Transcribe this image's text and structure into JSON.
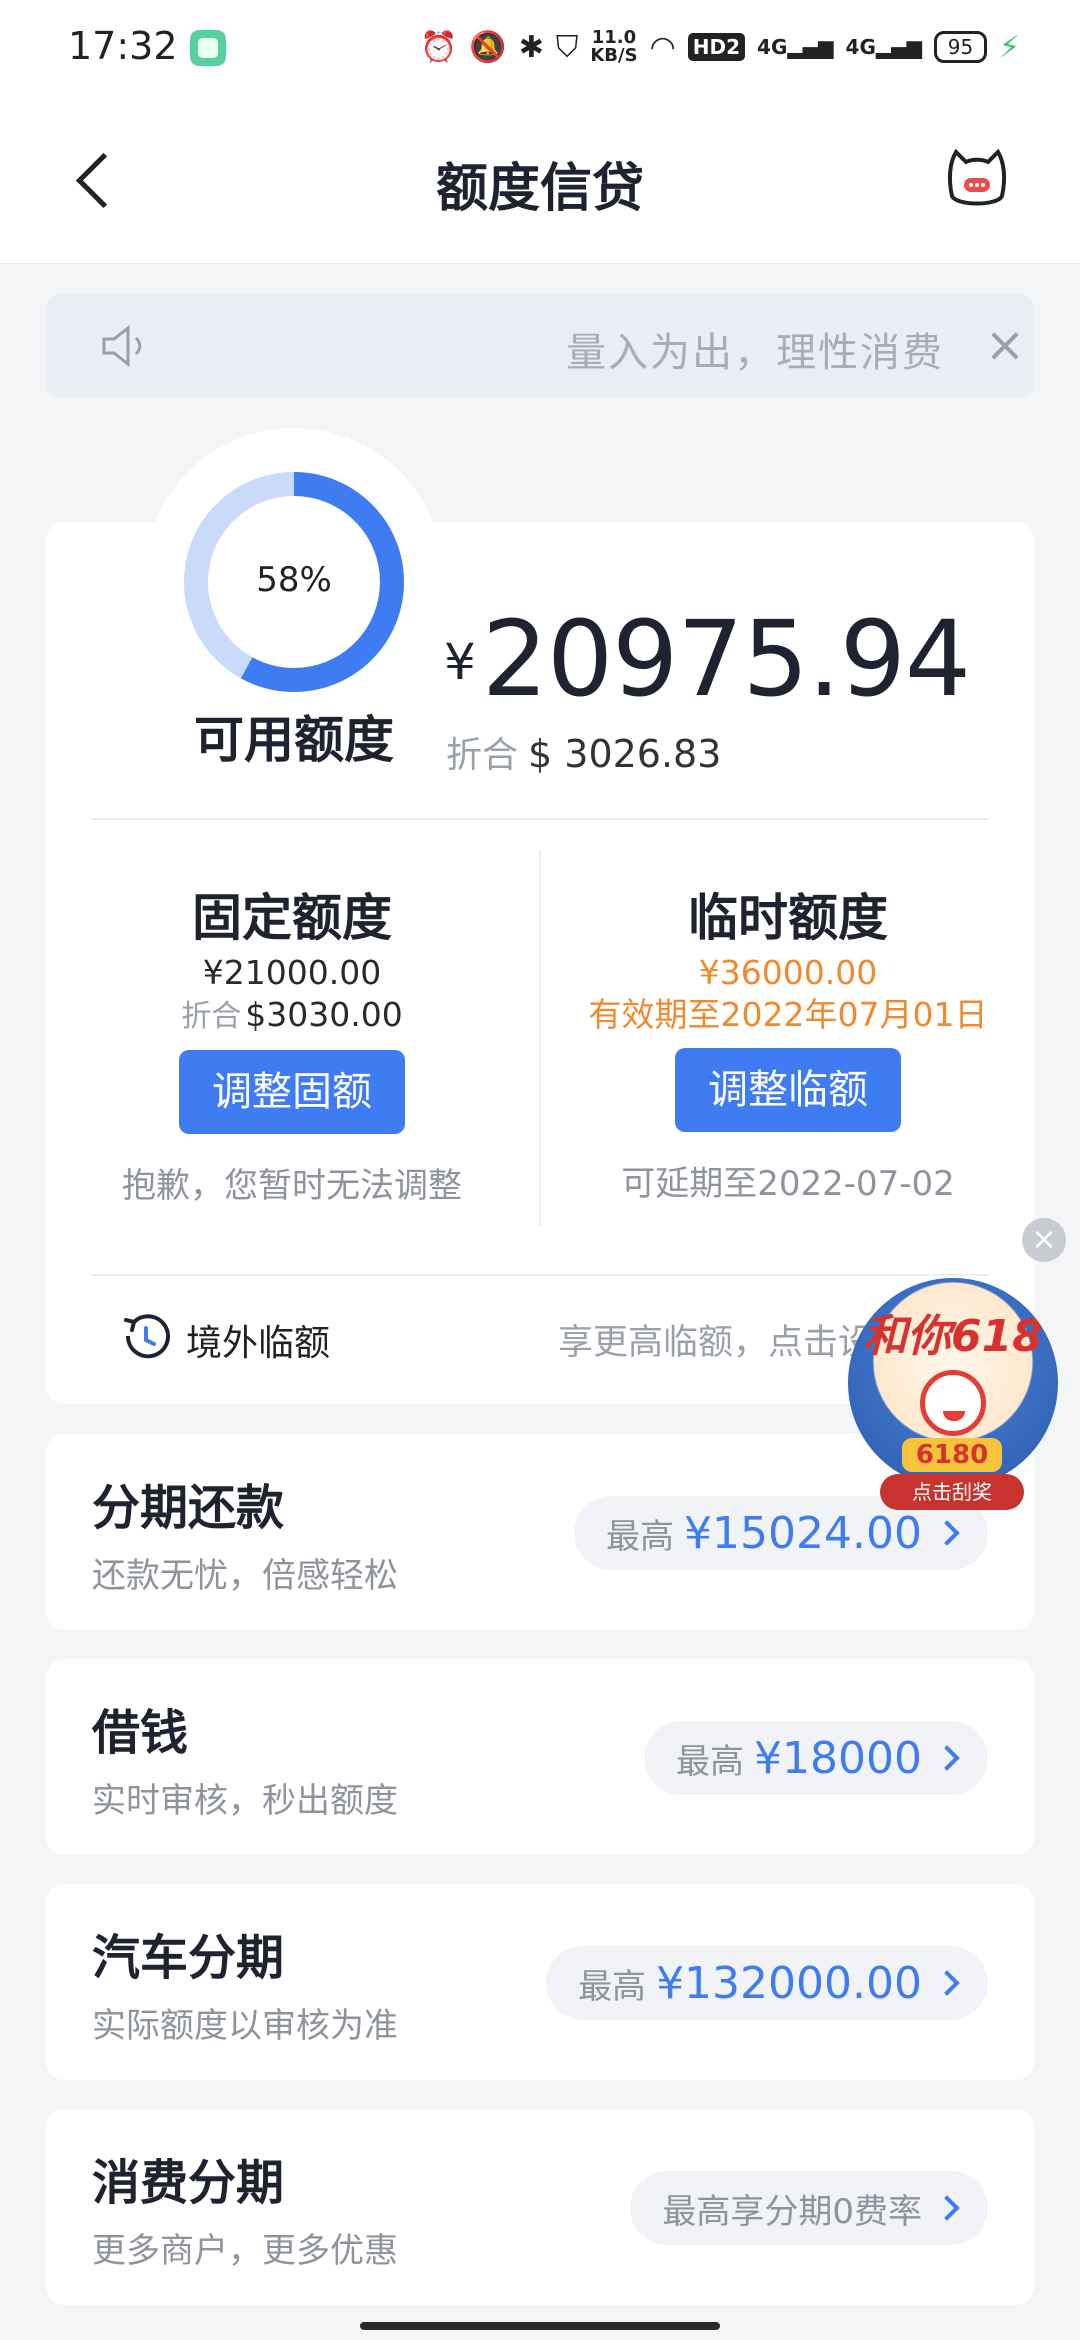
{
  "status_bar": {
    "time": "17:32",
    "net_speed_value": "11.0",
    "net_speed_unit": "KB/S",
    "hd_label": "HD2",
    "signal1": "4G",
    "signal2": "4G",
    "battery": "95"
  },
  "nav": {
    "title": "额度信贷"
  },
  "notice": {
    "text": "量入为出，理性消费"
  },
  "credit": {
    "ring_percent_label": "58%",
    "ring_percent": 0.58,
    "available_label": "可用额度",
    "currency_symbol": "¥",
    "available_amount": "20975.94",
    "usd_label": "折合",
    "usd_amount": "$ 3026.83"
  },
  "fixed": {
    "title": "固定额度",
    "amount": "¥21000.00",
    "usd_label": "折合",
    "usd_amount": "$3030.00",
    "button": "调整固额",
    "note": "抱歉，您暂时无法调整"
  },
  "temp": {
    "title": "临时额度",
    "amount": "¥36000.00",
    "valid_until": "有效期至2022年07月01日",
    "button": "调整临额",
    "note": "可延期至2022-07-02"
  },
  "abroad": {
    "label": "境外临额",
    "promo": "享更高临额，点击设置"
  },
  "products": [
    {
      "title": "分期还款",
      "subtitle": "还款无忧，倍感轻松",
      "prefix": "最高",
      "amount": "¥15024.00"
    },
    {
      "title": "借钱",
      "subtitle": "实时审核，秒出额度",
      "prefix": "最高",
      "amount": "¥18000"
    },
    {
      "title": "汽车分期",
      "subtitle": "实际额度以审核为准",
      "prefix": "最高",
      "amount": "¥132000.00"
    },
    {
      "title": "消费分期",
      "subtitle": "更多商户，更多优惠",
      "text": "最高享分期0费率"
    }
  ],
  "promo": {
    "title": "和你618",
    "badge": "6180",
    "button": "点击刮奖",
    "close": "×"
  },
  "colors": {
    "accent_blue": "#3f7cf2",
    "ring_light": "#c9dafa",
    "temp_orange": "#ef8a2e"
  }
}
